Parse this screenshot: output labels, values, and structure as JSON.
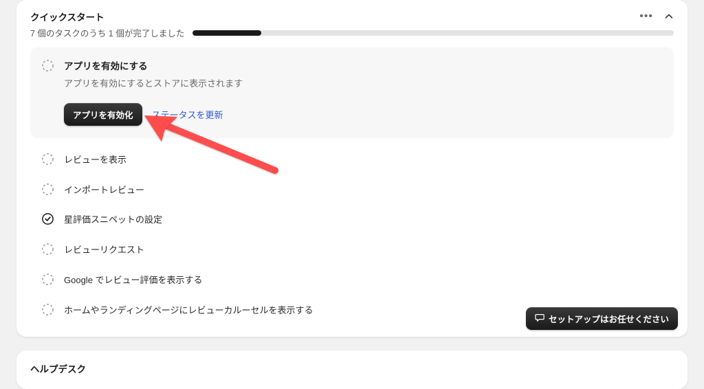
{
  "quickstart": {
    "title": "クイックスタート",
    "progress_text": "7 個のタスクのうち 1 個が完了しました",
    "progress_pct": 14.3,
    "expanded_task": {
      "title": "アプリを有効にする",
      "description": "アプリを有効にするとストアに表示されます",
      "primary_btn": "アプリを有効化",
      "secondary_link": "ステータスを更新"
    },
    "tasks": [
      {
        "title": "レビューを表示",
        "done": false
      },
      {
        "title": "インポートレビュー",
        "done": false
      },
      {
        "title": "星評価スニペットの設定",
        "done": true
      },
      {
        "title": "レビューリクエスト",
        "done": false
      },
      {
        "title": "Google でレビュー評価を表示する",
        "done": false
      },
      {
        "title": "ホームやランディングページにレビューカルーセルを表示する",
        "done": false
      }
    ],
    "footer_btn": "セットアップはお任せください"
  },
  "helpdesk": {
    "title": "ヘルプデスク"
  }
}
